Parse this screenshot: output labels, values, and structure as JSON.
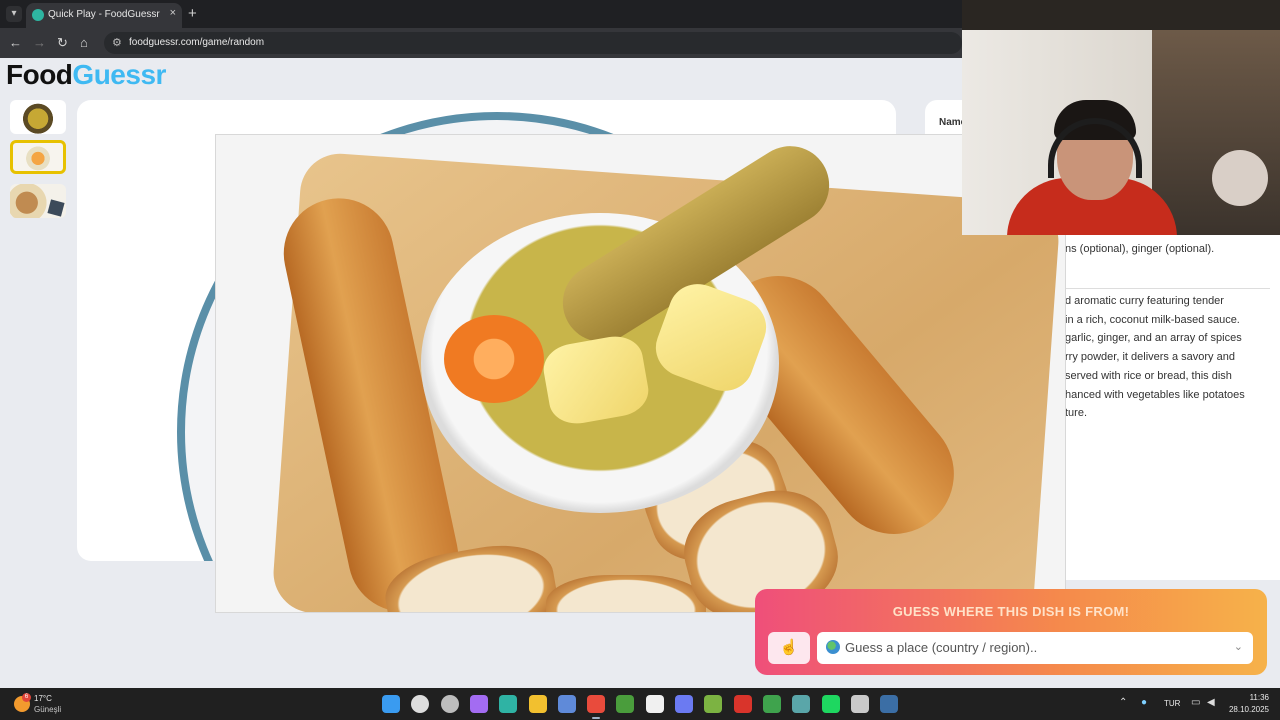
{
  "browser": {
    "tab_title": "Quick Play - FoodGuessr | Food",
    "tab_close": "×",
    "new_tab": "+",
    "url": "foodguessr.com/game/random",
    "back": "←",
    "forward": "→",
    "reload": "↻",
    "home": "⌂",
    "site_info": "⚙"
  },
  "logo": {
    "part1": "Food",
    "part2": "Guessr"
  },
  "side_panel": {
    "name_label": "Name",
    "ingredients_tail": "ns (optional), ginger (optional).",
    "description_lines": [
      "d aromatic curry featuring tender",
      "in a rich, coconut milk-based sauce.",
      "garlic, ginger, and an array of spices",
      "rry powder, it delivers a savory and",
      "served with rice or bread, this dish",
      "hanced with vegetables like potatoes",
      "ture."
    ]
  },
  "guess": {
    "title": "GUESS WHERE THIS DISH IS FROM!",
    "placeholder": "Guess a place (country / region)..",
    "hand_icon": "☝",
    "chevron": "⌄"
  },
  "taskbar": {
    "temperature": "17°C",
    "condition": "Güneşli",
    "weather_badge": "6",
    "language": "TUR",
    "time": "11:36",
    "date": "28.10.2025",
    "apps": [
      {
        "name": "start-icon",
        "color": "#3a9bf0"
      },
      {
        "name": "search-icon",
        "color": "#dddddd"
      },
      {
        "name": "task-view-icon",
        "color": "#bdbdbd"
      },
      {
        "name": "copilot-icon",
        "color": "#a36cf2"
      },
      {
        "name": "edge-icon",
        "color": "#2fb3a4"
      },
      {
        "name": "file-explorer-icon",
        "color": "#f2c02f"
      },
      {
        "name": "store-icon",
        "color": "#5f8ad9"
      },
      {
        "name": "chrome-icon",
        "color": "#e94b3c"
      },
      {
        "name": "minecraft-icon",
        "color": "#4a9d3c"
      },
      {
        "name": "capcut-icon",
        "color": "#f0f0f0"
      },
      {
        "name": "discord-icon",
        "color": "#6b7af2"
      },
      {
        "name": "app-icon",
        "color": "#7cb342"
      },
      {
        "name": "news-icon",
        "color": "#d9342b"
      },
      {
        "name": "xbox-icon",
        "color": "#3fa34d"
      },
      {
        "name": "globe-app-icon",
        "color": "#5aa6a9"
      },
      {
        "name": "spotify-icon",
        "color": "#1ed760"
      },
      {
        "name": "gauge-icon",
        "color": "#c9c9c9"
      },
      {
        "name": "steam-icon",
        "color": "#3b6ea5"
      }
    ]
  }
}
